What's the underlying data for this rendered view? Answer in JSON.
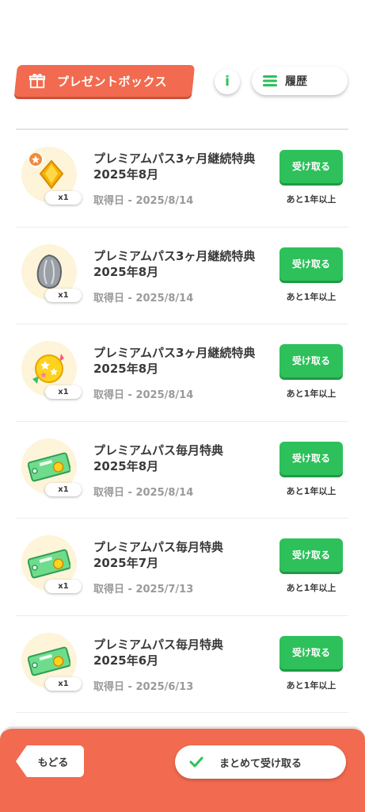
{
  "header": {
    "title": "プレゼントボックス",
    "info_label": "i",
    "history_label": "履歴"
  },
  "items": [
    {
      "icon": "premium-coin-gem-icon",
      "qty": "x1",
      "title_line1": "プレミアムパス3ヶ月継続特典",
      "title_line2": "2025年8月",
      "date": "取得日 - 2025/8/14",
      "button": "受け取る",
      "deadline": "あと1年以上"
    },
    {
      "icon": "gray-seed-icon",
      "qty": "x1",
      "title_line1": "プレミアムパス3ヶ月継続特典",
      "title_line2": "2025年8月",
      "date": "取得日 - 2025/8/14",
      "button": "受け取る",
      "deadline": "あと1年以上"
    },
    {
      "icon": "star-candy-icon",
      "qty": "x1",
      "title_line1": "プレミアムパス3ヶ月継続特典",
      "title_line2": "2025年8月",
      "date": "取得日 - 2025/8/14",
      "button": "受け取る",
      "deadline": "あと1年以上"
    },
    {
      "icon": "ticket-icon",
      "qty": "x1",
      "title_line1": "プレミアムパス毎月特典",
      "title_line2": "2025年8月",
      "date": "取得日 - 2025/8/14",
      "button": "受け取る",
      "deadline": "あと1年以上"
    },
    {
      "icon": "ticket-icon",
      "qty": "x1",
      "title_line1": "プレミアムパス毎月特典",
      "title_line2": "2025年7月",
      "date": "取得日 - 2025/7/13",
      "button": "受け取る",
      "deadline": "あと1年以上"
    },
    {
      "icon": "ticket-icon",
      "qty": "x1",
      "title_line1": "プレミアムパス毎月特典",
      "title_line2": "2025年6月",
      "date": "取得日 - 2025/6/13",
      "button": "受け取る",
      "deadline": "あと1年以上"
    }
  ],
  "footer": {
    "back_label": "もどる",
    "claim_all_label": "まとめて受け取る"
  },
  "colors": {
    "accent": "#f26a4f",
    "green": "#2ec05a",
    "icon_bg": "#fdf4d9"
  }
}
